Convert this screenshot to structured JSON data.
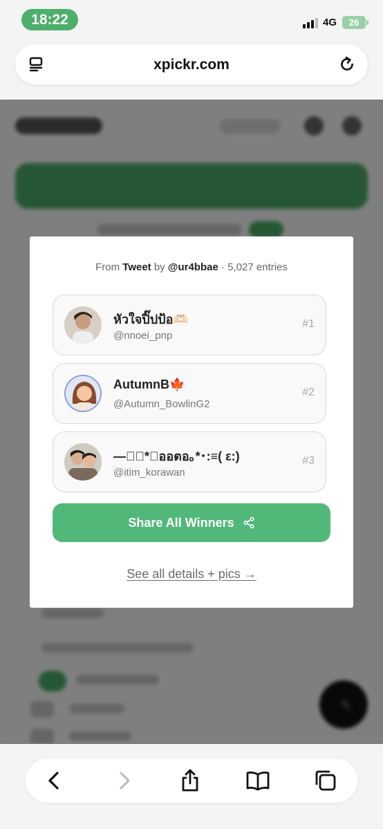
{
  "status_bar": {
    "time": "18:22",
    "network": "4G",
    "battery": "26",
    "accent_color": "#4caf6a"
  },
  "browser": {
    "url": "xpickr.com",
    "reader_icon": "reader-mode-icon",
    "reload_icon": "reload-icon"
  },
  "modal": {
    "source": {
      "prefix": "From",
      "type": "Tweet",
      "by": "by",
      "author": "@ur4bbae",
      "entries": "· 5,027 entries"
    },
    "winners": [
      {
        "name": "หัวใจปิ๊ปป้อ🫶🏻",
        "handle": "@nnoei_pnp",
        "rank": "#1"
      },
      {
        "name": "AutumnB🍁",
        "handle": "@Autumn_BowlinG2",
        "rank": "#2"
      },
      {
        "name": "—☆ﾟ*･ออตอ｡*･:≡( ε:)",
        "handle": "@itim_korawan",
        "rank": "#3"
      }
    ],
    "share_label": "Share All Winners",
    "share_icon": "share-icon",
    "details_link": "See all details + pics →",
    "button_color": "#52b87a"
  },
  "toolbar": {
    "back_icon": "chevron-left-icon",
    "forward_icon": "chevron-right-icon",
    "share_icon": "share-up-icon",
    "bookmarks_icon": "book-icon",
    "tabs_icon": "tabs-icon"
  }
}
